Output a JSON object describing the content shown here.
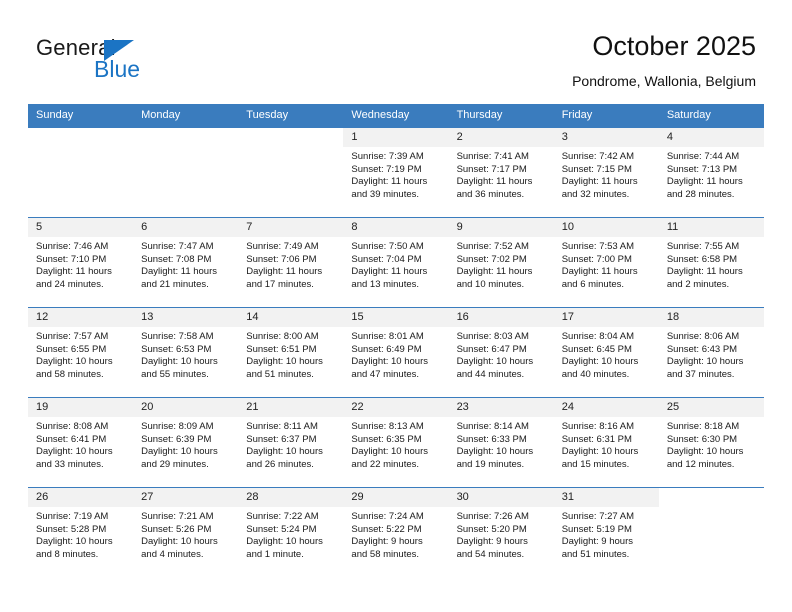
{
  "brand": {
    "name_line1": "General",
    "name_line2": "Blue",
    "accent_color": "#1b74c4",
    "logo_icon": "triangle-flag-icon"
  },
  "header": {
    "title": "October 2025",
    "subtitle": "Pondrome, Wallonia, Belgium"
  },
  "calendar": {
    "header_bg": "#3a7cbe",
    "daynum_bg": "#f2f2f2",
    "weekdays": [
      "Sunday",
      "Monday",
      "Tuesday",
      "Wednesday",
      "Thursday",
      "Friday",
      "Saturday"
    ],
    "weeks": [
      [
        {
          "day": ""
        },
        {
          "day": ""
        },
        {
          "day": ""
        },
        {
          "day": "1",
          "sunrise": "Sunrise: 7:39 AM",
          "sunset": "Sunset: 7:19 PM",
          "daylight1": "Daylight: 11 hours",
          "daylight2": "and 39 minutes."
        },
        {
          "day": "2",
          "sunrise": "Sunrise: 7:41 AM",
          "sunset": "Sunset: 7:17 PM",
          "daylight1": "Daylight: 11 hours",
          "daylight2": "and 36 minutes."
        },
        {
          "day": "3",
          "sunrise": "Sunrise: 7:42 AM",
          "sunset": "Sunset: 7:15 PM",
          "daylight1": "Daylight: 11 hours",
          "daylight2": "and 32 minutes."
        },
        {
          "day": "4",
          "sunrise": "Sunrise: 7:44 AM",
          "sunset": "Sunset: 7:13 PM",
          "daylight1": "Daylight: 11 hours",
          "daylight2": "and 28 minutes."
        }
      ],
      [
        {
          "day": "5",
          "sunrise": "Sunrise: 7:46 AM",
          "sunset": "Sunset: 7:10 PM",
          "daylight1": "Daylight: 11 hours",
          "daylight2": "and 24 minutes."
        },
        {
          "day": "6",
          "sunrise": "Sunrise: 7:47 AM",
          "sunset": "Sunset: 7:08 PM",
          "daylight1": "Daylight: 11 hours",
          "daylight2": "and 21 minutes."
        },
        {
          "day": "7",
          "sunrise": "Sunrise: 7:49 AM",
          "sunset": "Sunset: 7:06 PM",
          "daylight1": "Daylight: 11 hours",
          "daylight2": "and 17 minutes."
        },
        {
          "day": "8",
          "sunrise": "Sunrise: 7:50 AM",
          "sunset": "Sunset: 7:04 PM",
          "daylight1": "Daylight: 11 hours",
          "daylight2": "and 13 minutes."
        },
        {
          "day": "9",
          "sunrise": "Sunrise: 7:52 AM",
          "sunset": "Sunset: 7:02 PM",
          "daylight1": "Daylight: 11 hours",
          "daylight2": "and 10 minutes."
        },
        {
          "day": "10",
          "sunrise": "Sunrise: 7:53 AM",
          "sunset": "Sunset: 7:00 PM",
          "daylight1": "Daylight: 11 hours",
          "daylight2": "and 6 minutes."
        },
        {
          "day": "11",
          "sunrise": "Sunrise: 7:55 AM",
          "sunset": "Sunset: 6:58 PM",
          "daylight1": "Daylight: 11 hours",
          "daylight2": "and 2 minutes."
        }
      ],
      [
        {
          "day": "12",
          "sunrise": "Sunrise: 7:57 AM",
          "sunset": "Sunset: 6:55 PM",
          "daylight1": "Daylight: 10 hours",
          "daylight2": "and 58 minutes."
        },
        {
          "day": "13",
          "sunrise": "Sunrise: 7:58 AM",
          "sunset": "Sunset: 6:53 PM",
          "daylight1": "Daylight: 10 hours",
          "daylight2": "and 55 minutes."
        },
        {
          "day": "14",
          "sunrise": "Sunrise: 8:00 AM",
          "sunset": "Sunset: 6:51 PM",
          "daylight1": "Daylight: 10 hours",
          "daylight2": "and 51 minutes."
        },
        {
          "day": "15",
          "sunrise": "Sunrise: 8:01 AM",
          "sunset": "Sunset: 6:49 PM",
          "daylight1": "Daylight: 10 hours",
          "daylight2": "and 47 minutes."
        },
        {
          "day": "16",
          "sunrise": "Sunrise: 8:03 AM",
          "sunset": "Sunset: 6:47 PM",
          "daylight1": "Daylight: 10 hours",
          "daylight2": "and 44 minutes."
        },
        {
          "day": "17",
          "sunrise": "Sunrise: 8:04 AM",
          "sunset": "Sunset: 6:45 PM",
          "daylight1": "Daylight: 10 hours",
          "daylight2": "and 40 minutes."
        },
        {
          "day": "18",
          "sunrise": "Sunrise: 8:06 AM",
          "sunset": "Sunset: 6:43 PM",
          "daylight1": "Daylight: 10 hours",
          "daylight2": "and 37 minutes."
        }
      ],
      [
        {
          "day": "19",
          "sunrise": "Sunrise: 8:08 AM",
          "sunset": "Sunset: 6:41 PM",
          "daylight1": "Daylight: 10 hours",
          "daylight2": "and 33 minutes."
        },
        {
          "day": "20",
          "sunrise": "Sunrise: 8:09 AM",
          "sunset": "Sunset: 6:39 PM",
          "daylight1": "Daylight: 10 hours",
          "daylight2": "and 29 minutes."
        },
        {
          "day": "21",
          "sunrise": "Sunrise: 8:11 AM",
          "sunset": "Sunset: 6:37 PM",
          "daylight1": "Daylight: 10 hours",
          "daylight2": "and 26 minutes."
        },
        {
          "day": "22",
          "sunrise": "Sunrise: 8:13 AM",
          "sunset": "Sunset: 6:35 PM",
          "daylight1": "Daylight: 10 hours",
          "daylight2": "and 22 minutes."
        },
        {
          "day": "23",
          "sunrise": "Sunrise: 8:14 AM",
          "sunset": "Sunset: 6:33 PM",
          "daylight1": "Daylight: 10 hours",
          "daylight2": "and 19 minutes."
        },
        {
          "day": "24",
          "sunrise": "Sunrise: 8:16 AM",
          "sunset": "Sunset: 6:31 PM",
          "daylight1": "Daylight: 10 hours",
          "daylight2": "and 15 minutes."
        },
        {
          "day": "25",
          "sunrise": "Sunrise: 8:18 AM",
          "sunset": "Sunset: 6:30 PM",
          "daylight1": "Daylight: 10 hours",
          "daylight2": "and 12 minutes."
        }
      ],
      [
        {
          "day": "26",
          "sunrise": "Sunrise: 7:19 AM",
          "sunset": "Sunset: 5:28 PM",
          "daylight1": "Daylight: 10 hours",
          "daylight2": "and 8 minutes."
        },
        {
          "day": "27",
          "sunrise": "Sunrise: 7:21 AM",
          "sunset": "Sunset: 5:26 PM",
          "daylight1": "Daylight: 10 hours",
          "daylight2": "and 4 minutes."
        },
        {
          "day": "28",
          "sunrise": "Sunrise: 7:22 AM",
          "sunset": "Sunset: 5:24 PM",
          "daylight1": "Daylight: 10 hours",
          "daylight2": "and 1 minute."
        },
        {
          "day": "29",
          "sunrise": "Sunrise: 7:24 AM",
          "sunset": "Sunset: 5:22 PM",
          "daylight1": "Daylight: 9 hours",
          "daylight2": "and 58 minutes."
        },
        {
          "day": "30",
          "sunrise": "Sunrise: 7:26 AM",
          "sunset": "Sunset: 5:20 PM",
          "daylight1": "Daylight: 9 hours",
          "daylight2": "and 54 minutes."
        },
        {
          "day": "31",
          "sunrise": "Sunrise: 7:27 AM",
          "sunset": "Sunset: 5:19 PM",
          "daylight1": "Daylight: 9 hours",
          "daylight2": "and 51 minutes."
        },
        {
          "day": ""
        }
      ]
    ]
  }
}
